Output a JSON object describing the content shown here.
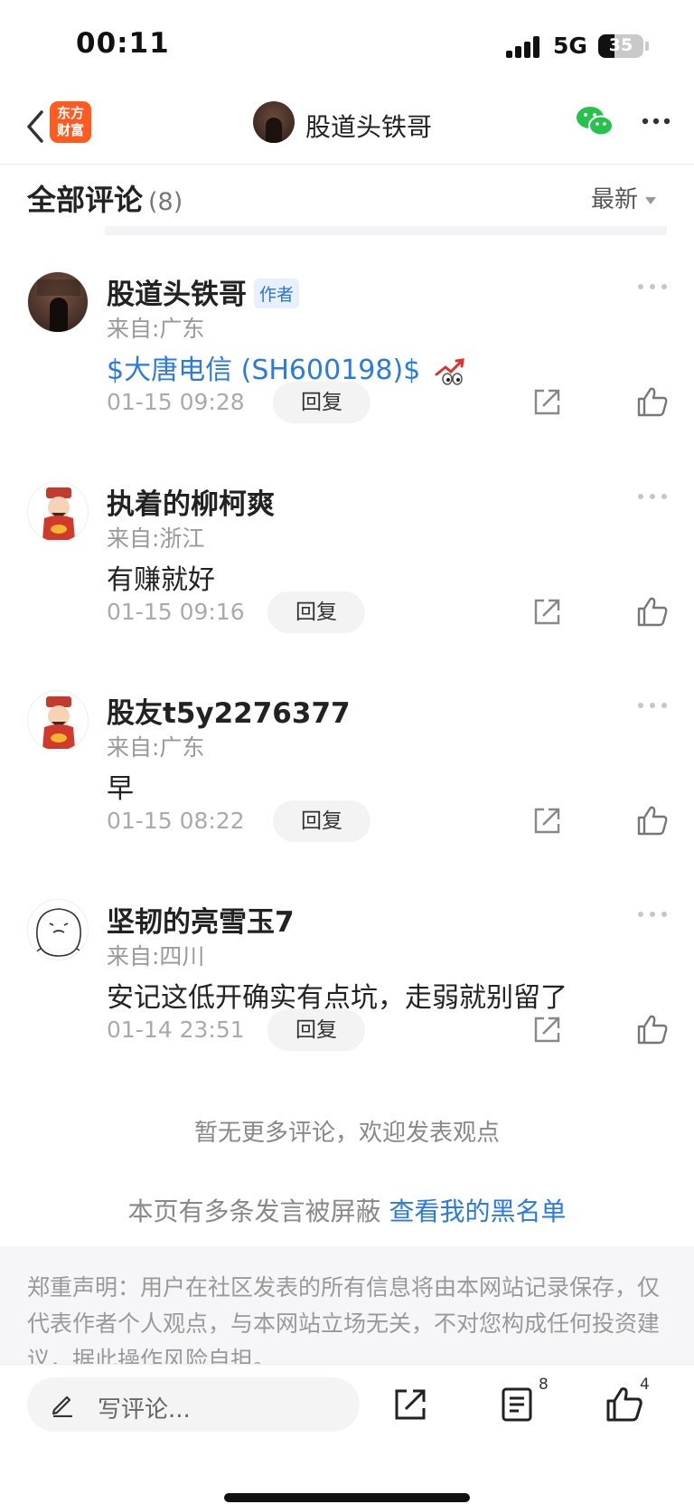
{
  "status_bar": {
    "time": "00:11",
    "network": "5G",
    "battery": "35",
    "battery_level": 0.35
  },
  "nav": {
    "logo_line1": "东方",
    "logo_line2": "财富",
    "title": "股道头铁哥"
  },
  "comments_header": {
    "title": "全部评论",
    "count": "(8)",
    "sort_label": "最新"
  },
  "comments": [
    {
      "name": "股道头铁哥",
      "tag": "作者",
      "location": "来自:广东",
      "text": "$大唐电信 (SH600198)$",
      "time": "01-15 09:28",
      "reply": "回复"
    },
    {
      "name": "执着的柳柯爽",
      "location": "来自:浙江",
      "text": "有赚就好",
      "time": "01-15 09:16",
      "reply": "回复"
    },
    {
      "name": "股友t5y2276377",
      "location": "来自:广东",
      "text": "早",
      "time": "01-15 08:22",
      "reply": "回复"
    },
    {
      "name": "坚韧的亮雪玉7",
      "location": "来自:四川",
      "text": "安记这低开确实有点坑，走弱就别留了",
      "time": "01-14 23:51",
      "reply": "回复"
    }
  ],
  "footer": {
    "no_more": "暂无更多评论，欢迎发表观点",
    "blocked_text": "本页有多条发言被屏蔽",
    "blocked_link": "查看我的黑名单",
    "disclaimer": "郑重声明：用户在社区发表的所有信息将由本网站记录保存，仅代表作者个人观点，与本网站立场无关，不对您构成任何投资建议，据此操作风险自担。"
  },
  "bottom_bar": {
    "placeholder": "写评论...",
    "comment_count": "8",
    "like_count": "4"
  }
}
